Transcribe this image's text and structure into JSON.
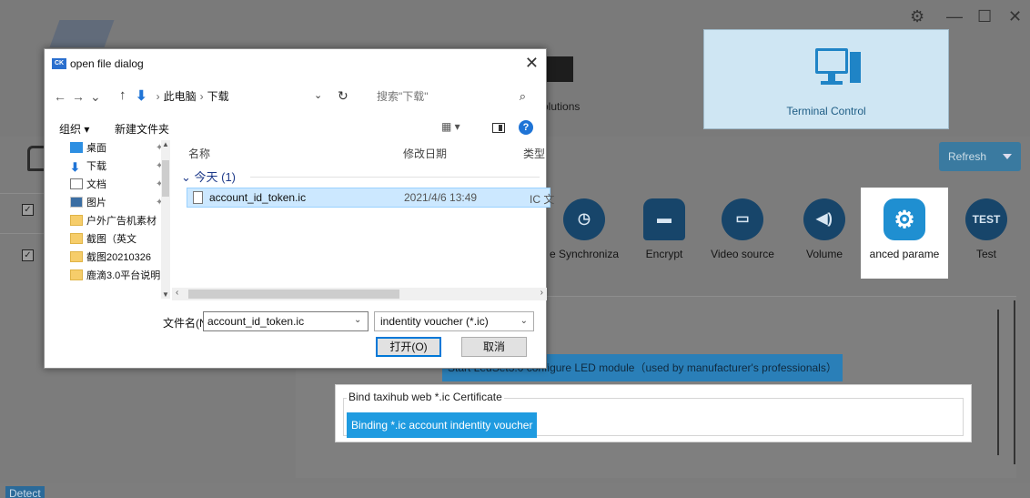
{
  "app": {
    "nav": {
      "solutions_label": "olutions",
      "terminal_control_label": "Terminal Control"
    },
    "refresh_label": "Refresh",
    "functions": [
      {
        "label": "e Synchroniza",
        "icon": "clock-sync-icon"
      },
      {
        "label": "Encrypt",
        "icon": "lock-icon"
      },
      {
        "label": "Video source",
        "icon": "video-connector-icon"
      },
      {
        "label": "Volume",
        "icon": "speaker-icon"
      },
      {
        "label": "anced parame",
        "icon": "gear-icon"
      },
      {
        "label": "Test",
        "icon": "test-icon",
        "badge": "TEST"
      }
    ],
    "ledset_button": "Start LedSet3.0 configure LED module（used by manufacturer's professionals）",
    "bind_section": {
      "legend": "Bind taxihub web *.ic Certificate",
      "button": "Binding *.ic account indentity voucher"
    },
    "status_label": "Detect"
  },
  "dialog": {
    "title": "open file dialog",
    "app_icon_text": "CK",
    "breadcrumb": [
      "此电脑",
      "下载"
    ],
    "search_placeholder": "搜索\"下载\"",
    "toolbar": {
      "organize": "组织 ▾",
      "new_folder": "新建文件夹"
    },
    "nav_items": [
      {
        "label": "桌面",
        "icon": "desktop",
        "pinned": true
      },
      {
        "label": "下载",
        "icon": "download",
        "pinned": true
      },
      {
        "label": "文档",
        "icon": "document",
        "pinned": true
      },
      {
        "label": "图片",
        "icon": "picture",
        "pinned": true
      },
      {
        "label": "户外广告机素材",
        "icon": "folder",
        "pinned": false
      },
      {
        "label": "截图（英文",
        "icon": "folder",
        "pinned": false
      },
      {
        "label": "截图20210326",
        "icon": "folder",
        "pinned": false
      },
      {
        "label": "鹿滴3.0平台说明",
        "icon": "folder",
        "pinned": false
      }
    ],
    "columns": {
      "name": "名称",
      "date": "修改日期",
      "type": "类型"
    },
    "group_label": "今天 (1)",
    "files": [
      {
        "name": "account_id_token.ic",
        "date": "2021/4/6 13:49",
        "type": "IC 文"
      }
    ],
    "filename_label": "文件名(N):",
    "filename_value": "account_id_token.ic",
    "filter": "indentity voucher (*.ic)",
    "open_button": "打开(O)",
    "cancel_button": "取消"
  }
}
